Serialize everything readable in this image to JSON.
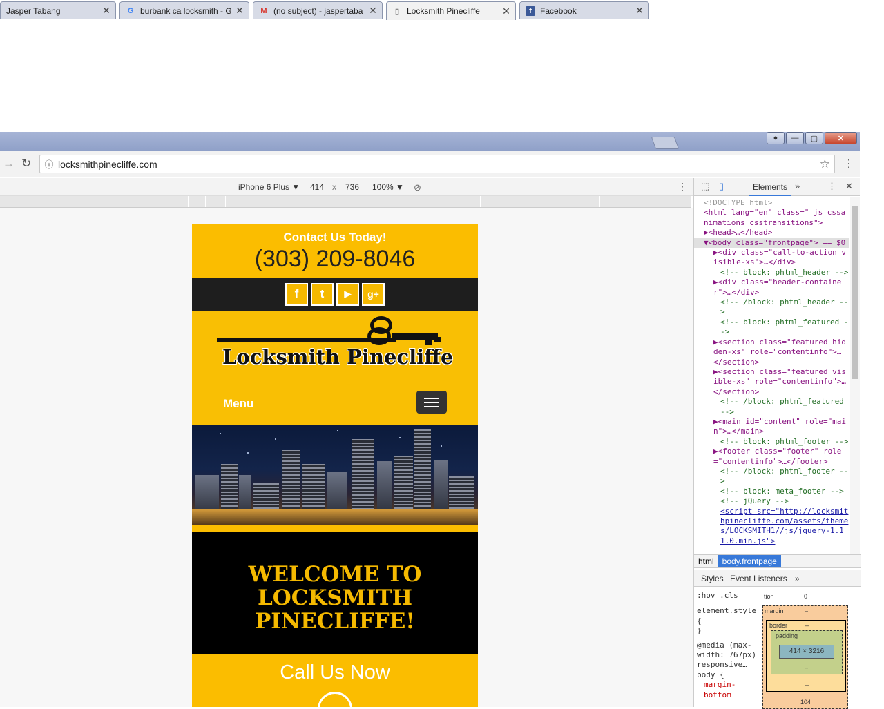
{
  "browser": {
    "tabs": [
      {
        "label": "Jasper Tabang",
        "icon": "person-icon"
      },
      {
        "label": "burbank ca locksmith - G",
        "icon": "google-icon"
      },
      {
        "label": "(no subject) - jaspertaba",
        "icon": "gmail-icon"
      },
      {
        "label": "Locksmith Pinecliffe",
        "icon": "page-icon",
        "active": true
      },
      {
        "label": "Facebook",
        "icon": "facebook-icon"
      }
    ],
    "url": "locksmithpinecliffe.com"
  },
  "device_toolbar": {
    "device": "iPhone 6 Plus",
    "width": "414",
    "times": "x",
    "height": "736",
    "zoom": "100%"
  },
  "page": {
    "cta_heading": "Contact Us Today!",
    "phone": "(303) 209-8046",
    "social": [
      "f",
      "t",
      "▶",
      "g+"
    ],
    "logo_text": "Locksmith Pinecliffe",
    "menu_label": "Menu",
    "welcome_text": "WELCOME TO LOCKSMITH PINECLIFFE!",
    "call_now": "Call Us Now"
  },
  "devtools": {
    "active_tab": "Elements",
    "dom_lines": [
      "<!DOCTYPE html>",
      "<html lang=\"en\" class=\" js cssanimations csstransitions\">",
      "▶<head>…</head>",
      "▼<body class=\"frontpage\"> == $0",
      "▶<div class=\"call-to-action visible-xs\">…</div>",
      "<!-- block: phtml_header -->",
      "▶<div class=\"header-container\">…</div>",
      "<!-- /block: phtml_header -->",
      "<!-- block: phtml_featured -->",
      "▶<section class=\"featured hidden-xs\" role=\"contentinfo\">…</section>",
      "▶<section class=\"featured visible-xs\" role=\"contentinfo\">…</section>",
      "<!-- /block: phtml_featured -->",
      "▶<main id=\"content\" role=\"main\">…</main>",
      "<!-- block: phtml_footer -->",
      "▶<footer class=\"footer\" role=\"contentinfo\">…</footer>",
      "<!-- /block: phtml_footer -->",
      "<!-- block: meta_footer -->",
      "<!-- jQuery -->",
      "<script src=\"http://locksmithpinecliffe.com/assets/themes/LOCKSMITH1//js/jquery-1.11.0.min.js\">"
    ],
    "breadcrumbs": [
      "html",
      "body.frontpage"
    ],
    "styles_tabs": [
      "Styles",
      "Event Listeners"
    ],
    "styles_filter": [
      ":hov",
      ".cls"
    ],
    "styles_rules": [
      "element.style {",
      "}",
      "@media (max-width: 767px)",
      "responsive…",
      "body {",
      "margin-bottom"
    ],
    "box_model": {
      "position": "0",
      "margin_label": "margin",
      "border_label": "border",
      "padding_label": "padding",
      "dash": "–",
      "content": "414 × 3216",
      "bottom": "104"
    }
  }
}
